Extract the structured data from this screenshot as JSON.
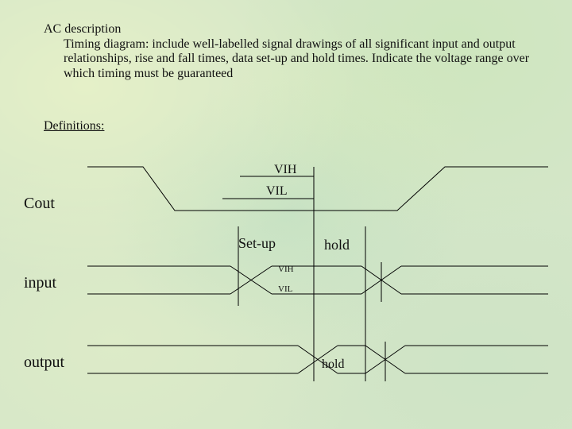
{
  "heading": "AC description",
  "paragraph": "Timing diagram: include well-labelled signal drawings of all significant input and output relationships, rise and fall times, data set-up and hold times. Indicate the voltage range over which timing must be guaranteed",
  "definitions": "Definitions:",
  "signals": {
    "cout": {
      "label": "Cout",
      "vih": "VIH",
      "vil": "VIL"
    },
    "input": {
      "label": "input",
      "vih": "VIH",
      "vil": "VIL"
    },
    "output": {
      "label": "output"
    }
  },
  "setup_label": "Set-up",
  "hold_label_1": "hold",
  "hold_label_2": "hold",
  "chart_data": {
    "type": "timing-diagram",
    "title": "AC description timing diagram",
    "signals": [
      {
        "name": "Cout",
        "thresholds": [
          "VIH",
          "VIL"
        ],
        "waveform": "high-fall-low-rise-high",
        "annotations": [
          {
            "name": "Set-up",
            "region": "before falling edge"
          },
          {
            "name": "hold",
            "region": "after falling edge"
          }
        ]
      },
      {
        "name": "input",
        "thresholds": [
          "VIH",
          "VIL"
        ],
        "waveform": "data-valid-window with crossing transitions",
        "annotations": []
      },
      {
        "name": "output",
        "waveform": "data-valid-window with crossing transitions",
        "annotations": [
          {
            "name": "hold",
            "region": "between transitions"
          }
        ]
      }
    ]
  }
}
